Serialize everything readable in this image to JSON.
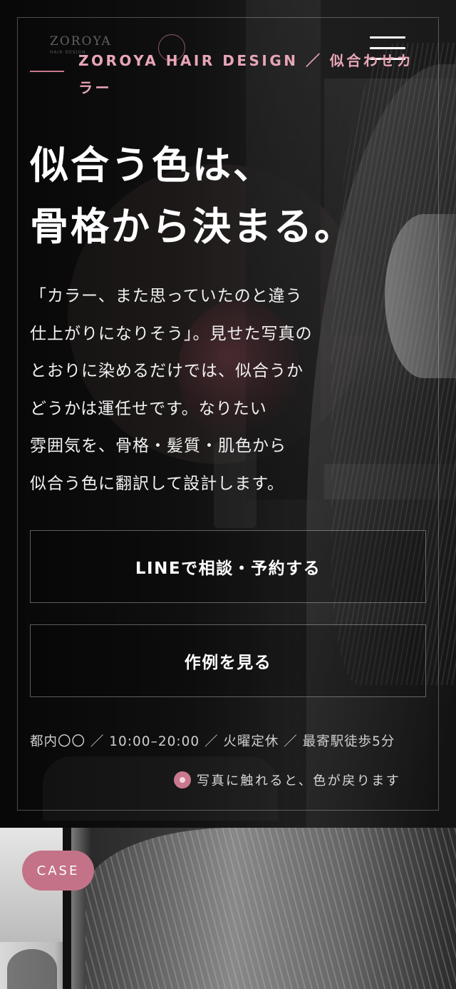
{
  "header": {
    "logo_text": "ZOROYA",
    "logo_sub": "HAIR DESIGN",
    "breadcrumb": "ZOROYA HAIR DESIGN ／ 似合わせカラー",
    "menu_icon": "hamburger-menu-icon"
  },
  "hero": {
    "headline": [
      "似合う色は、",
      "骨格から決まる。"
    ],
    "lead": [
      "「カラー、また思っていたのと違う",
      "仕上がりになりそう」。見せた写真の",
      "とおりに染めるだけでは、似合うか",
      "どうかは運任せです。なりたい",
      "雰囲気を、骨格・髪質・肌色から",
      "似合う色に翻訳して設計します。"
    ],
    "cta_line": "LINEで相談・予約する",
    "cta_works": "作例を見る",
    "info": "都内〇〇 ／ 10:00–20:00 ／ 火曜定休 ／ 最寄駅徒歩5分",
    "hint": "写真に触れると、色が戻ります"
  },
  "case": {
    "badge": "CASE"
  },
  "colors": {
    "accent_pink": "#c9788d",
    "badge_pink": "#c47287",
    "eyebrow_pink": "#e8a6b7"
  }
}
